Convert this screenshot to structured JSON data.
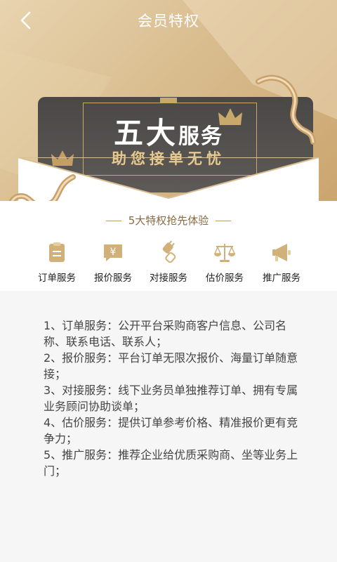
{
  "header": {
    "title": "会员特权",
    "back_icon": "chevron-left-icon"
  },
  "hero": {
    "headline_big": "五大",
    "headline_small": "服务",
    "subline": "助您接单无忧",
    "accent_color": "#c9a86c",
    "card_color": "#4f4c4a"
  },
  "tagline": "5大特权抢先体验",
  "services": [
    {
      "label": "订单服务",
      "icon": "order-icon"
    },
    {
      "label": "报价服务",
      "icon": "quote-icon"
    },
    {
      "label": "对接服务",
      "icon": "connect-icon"
    },
    {
      "label": "估价服务",
      "icon": "scale-icon"
    },
    {
      "label": "推广服务",
      "icon": "megaphone-icon"
    }
  ],
  "description": [
    "1、订单服务：公开平台采购商客户信息、公司名称、联系电话、联系人；",
    "2、报价服务：平台订单无限次报价、海量订单随意接；",
    "3、对接服务：线下业务员单独推荐订单、拥有专属业务顾问协助谈单；",
    "4、估价服务：提供订单参考价格、精准报价更有竞争力；",
    "5、推广服务：推荐企业给优质采购商、坐等业务上门；"
  ]
}
